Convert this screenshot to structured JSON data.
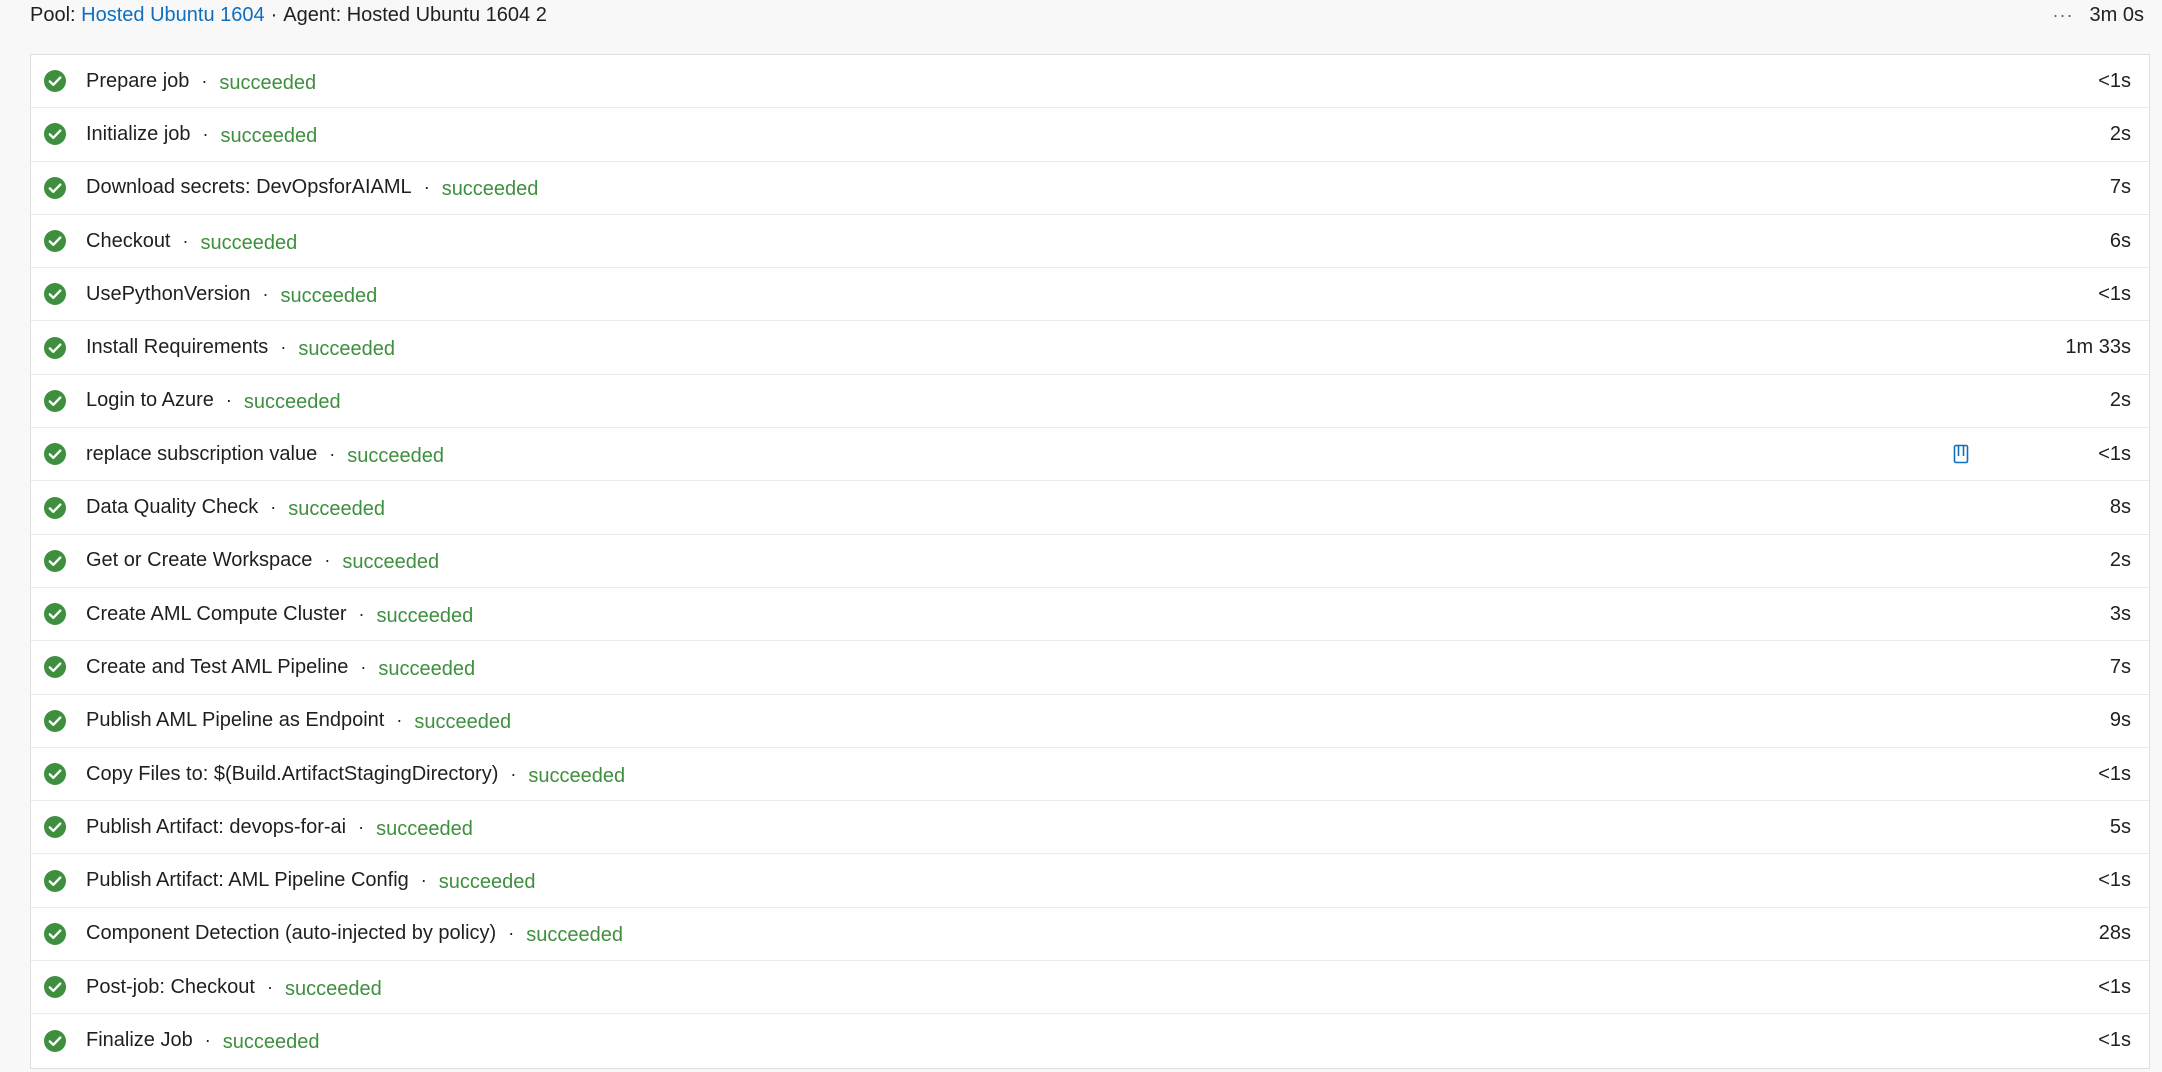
{
  "header": {
    "pool_label": "Pool:",
    "pool_name": "Hosted Ubuntu 1604",
    "separator": "·",
    "agent_label": "Agent:",
    "agent_name": "Hosted Ubuntu 1604 2",
    "more_label": "···",
    "total_duration": "3m 0s"
  },
  "status_color": "#3e8f3e",
  "link_color": "#106ebe",
  "steps": [
    {
      "name": "Prepare job",
      "status": "succeeded",
      "duration": "<1s"
    },
    {
      "name": "Initialize job",
      "status": "succeeded",
      "duration": "2s"
    },
    {
      "name": "Download secrets: DevOpsforAIAML",
      "status": "succeeded",
      "duration": "7s"
    },
    {
      "name": "Checkout",
      "status": "succeeded",
      "duration": "6s"
    },
    {
      "name": "UsePythonVersion",
      "status": "succeeded",
      "duration": "<1s"
    },
    {
      "name": "Install Requirements",
      "status": "succeeded",
      "duration": "1m 33s"
    },
    {
      "name": "Login to Azure",
      "status": "succeeded",
      "duration": "2s"
    },
    {
      "name": "replace subscription value",
      "status": "succeeded",
      "duration": "<1s",
      "extra_icon": "document-icon"
    },
    {
      "name": "Data Quality Check",
      "status": "succeeded",
      "duration": "8s"
    },
    {
      "name": "Get or Create Workspace",
      "status": "succeeded",
      "duration": "2s"
    },
    {
      "name": "Create AML Compute Cluster",
      "status": "succeeded",
      "duration": "3s"
    },
    {
      "name": "Create and Test AML Pipeline",
      "status": "succeeded",
      "duration": "7s"
    },
    {
      "name": "Publish AML Pipeline as Endpoint",
      "status": "succeeded",
      "duration": "9s"
    },
    {
      "name": "Copy Files to: $(Build.ArtifactStagingDirectory)",
      "status": "succeeded",
      "duration": "<1s"
    },
    {
      "name": "Publish Artifact: devops-for-ai",
      "status": "succeeded",
      "duration": "5s"
    },
    {
      "name": "Publish Artifact: AML Pipeline Config",
      "status": "succeeded",
      "duration": "<1s"
    },
    {
      "name": "Component Detection (auto-injected by policy)",
      "status": "succeeded",
      "duration": "28s"
    },
    {
      "name": "Post-job: Checkout",
      "status": "succeeded",
      "duration": "<1s"
    },
    {
      "name": "Finalize Job",
      "status": "succeeded",
      "duration": "<1s"
    }
  ]
}
